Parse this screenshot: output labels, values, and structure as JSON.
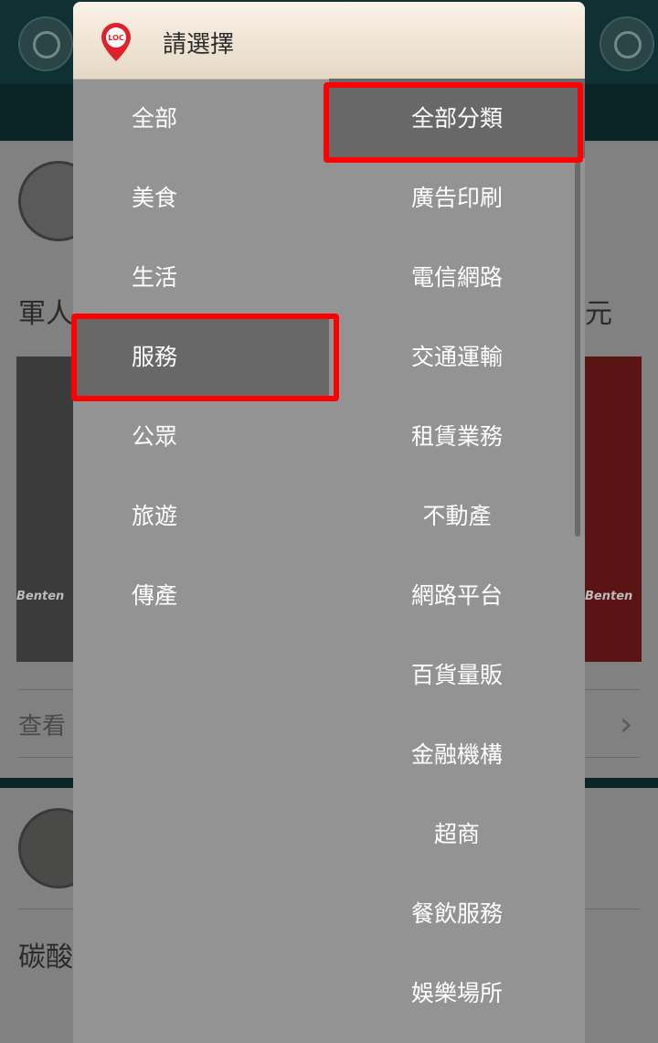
{
  "background_app": {
    "card1_title": "軍人",
    "card1_title_right": "元",
    "card1_link": "查看",
    "card2_title": "碳酸",
    "product_brand": "Benten"
  },
  "dialog": {
    "title": "請選擇",
    "logo_text": "LOC",
    "left_items": [
      {
        "label": "全部"
      },
      {
        "label": "美食"
      },
      {
        "label": "生活"
      },
      {
        "label": "服務"
      },
      {
        "label": "公眾"
      },
      {
        "label": "旅遊"
      },
      {
        "label": "傳產"
      }
    ],
    "left_selected_index": 3,
    "right_items": [
      {
        "label": "全部分類"
      },
      {
        "label": "廣告印刷"
      },
      {
        "label": "電信網路"
      },
      {
        "label": "交通運輸"
      },
      {
        "label": "租賃業務"
      },
      {
        "label": "不動產"
      },
      {
        "label": "網路平台"
      },
      {
        "label": "百貨量販"
      },
      {
        "label": "金融機構"
      },
      {
        "label": "超商"
      },
      {
        "label": "餐飲服務"
      },
      {
        "label": "娛樂場所"
      }
    ],
    "right_selected_index": 0
  },
  "colors": {
    "highlight": "#ff0000",
    "accent_pin": "#e0202a",
    "dialog_bg": "#939393",
    "selected_bg": "#686868"
  }
}
